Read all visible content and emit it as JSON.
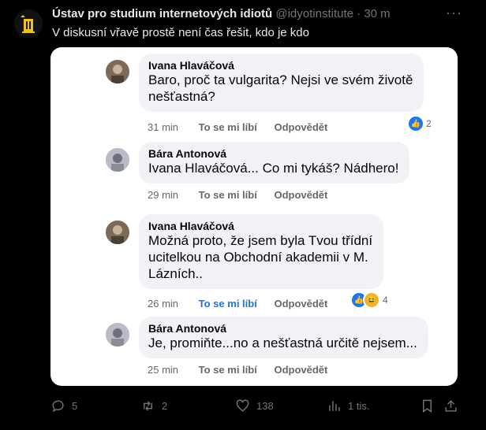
{
  "tweet": {
    "author_name": "Ústav pro studium internetových idiotů",
    "handle": "@idyotinstitute",
    "separator": "·",
    "time": "30 m",
    "more_icon": "more-dots-icon",
    "text": "V diskusní vřavě prostě není čas řešit, kdo je kdo",
    "accent_color": "#f5c400"
  },
  "comments": [
    {
      "name": "Ivana Hlaváčová",
      "lines": [
        "Baro, proč ta vulgarita? Nejsi ve svém životě",
        "nešťastná?"
      ],
      "time": "31 min",
      "like": "To se mi líbí",
      "reply": "Odpovědět",
      "reaction_count": "2"
    },
    {
      "name": "Bára Antonová",
      "lines": [
        "Ivana Hlaváčová... Co mi tykáš? Nádhero!"
      ],
      "time": "29 min",
      "like": "To se mi líbí",
      "reply": "Odpovědět"
    },
    {
      "name": "Ivana Hlaváčová",
      "lines": [
        "Možná proto, že jsem byla Tvou třídní",
        "ucitelkou na Obchodní akademii v M.",
        "Lázních.."
      ],
      "time": "26 min",
      "like": "To se mi líbí",
      "reply": "Odpovědět",
      "reaction_count": "4"
    },
    {
      "name": "Bára Antonová",
      "lines": [
        "Je, promiňte...no a nešťastná určitě nejsem..."
      ],
      "time": "25 min",
      "like": "To se mi líbí",
      "reply": "Odpovědět"
    }
  ],
  "actions": {
    "replies": "5",
    "retweets": "2",
    "likes": "138",
    "views": "1 tis."
  }
}
